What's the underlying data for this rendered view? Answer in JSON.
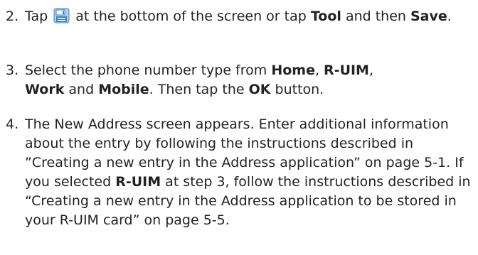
{
  "steps": [
    {
      "number": "2.",
      "icon": "save-icon",
      "text_a": "Tap",
      "text_b": "at the bottom of the screen or tap",
      "bold_a": "Tool",
      "text_c": "and then",
      "bold_b": "Save",
      "text_d": "."
    },
    {
      "number": "3.",
      "text_a": "Select the phone number type from",
      "bold_a": "Home",
      "sep_a": ",",
      "bold_b": "R-UIM",
      "sep_b": ",",
      "bold_c": "Work",
      "text_b": "and",
      "bold_d": "Mobile",
      "text_c": ". Then tap the",
      "bold_e": "OK",
      "text_d": "button."
    },
    {
      "number": "4.",
      "text_a": "The New Address screen appears. Enter additional information about the entry by following the instructions described in ”Creating a new entry in the Address application” on page 5-1. If you selected",
      "bold_a": "R-UIM",
      "text_b": "at step 3, follow the instructions described in “Creating a new entry in the Address application to be stored in your R-UIM card” on page 5-5."
    }
  ],
  "colors": {
    "text": "#222222",
    "icon_blue": "#3b82c4",
    "icon_light": "#a9d0ef"
  }
}
